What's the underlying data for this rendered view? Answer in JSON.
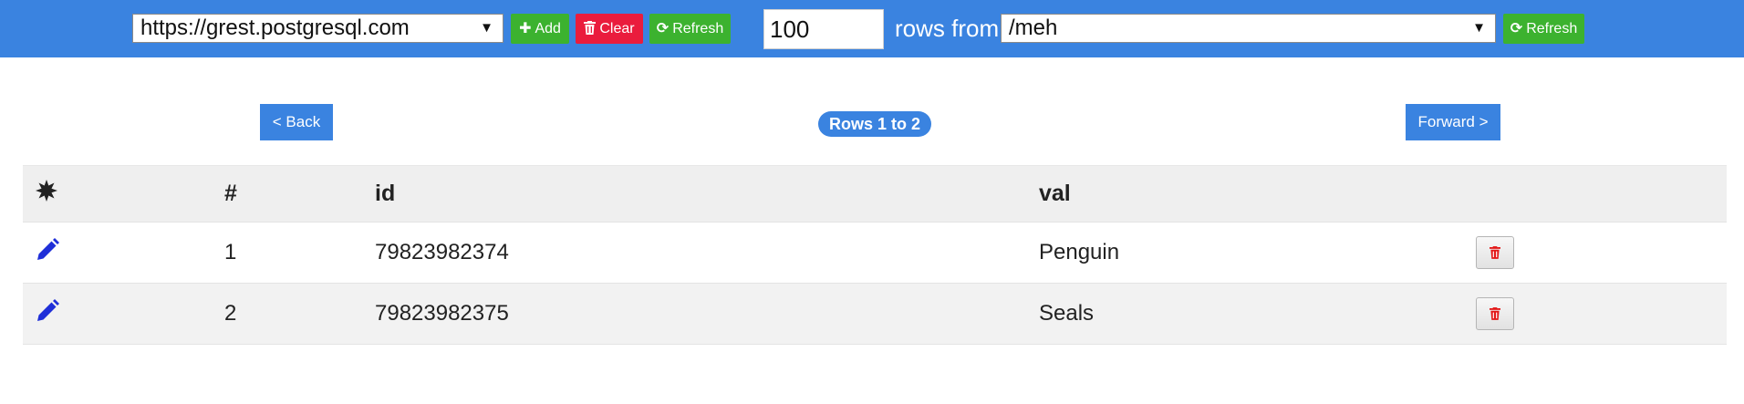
{
  "toolbar": {
    "server_select": "https://grest.postgresql.com",
    "add_label": "Add",
    "clear_label": "Clear",
    "refresh_label": "Refresh",
    "rows_count": "100",
    "rows_from_label": "rows from",
    "table_select": "/meh",
    "refresh2_label": "Refresh"
  },
  "pager": {
    "back_label": "< Back",
    "rows_badge": "Rows 1 to 2",
    "forward_label": "Forward >"
  },
  "table": {
    "headers": {
      "num": "#",
      "id": "id",
      "val": "val"
    },
    "rows": [
      {
        "num": "1",
        "id": "79823982374",
        "val": "Penguin"
      },
      {
        "num": "2",
        "id": "79823982375",
        "val": "Seals"
      }
    ]
  },
  "icons": {
    "select_all": "starburst-icon",
    "edit": "pencil-icon",
    "delete": "trash-icon",
    "add": "plus-icon",
    "clear": "trash-icon",
    "refresh": "refresh-icon",
    "dropdown": "caret-down-icon"
  },
  "colors": {
    "topbar": "#3a83e0",
    "green": "#3cb22f",
    "red": "#ea1c3d",
    "edit_icon": "#1f2fd8",
    "delete_icon": "#e31818"
  }
}
